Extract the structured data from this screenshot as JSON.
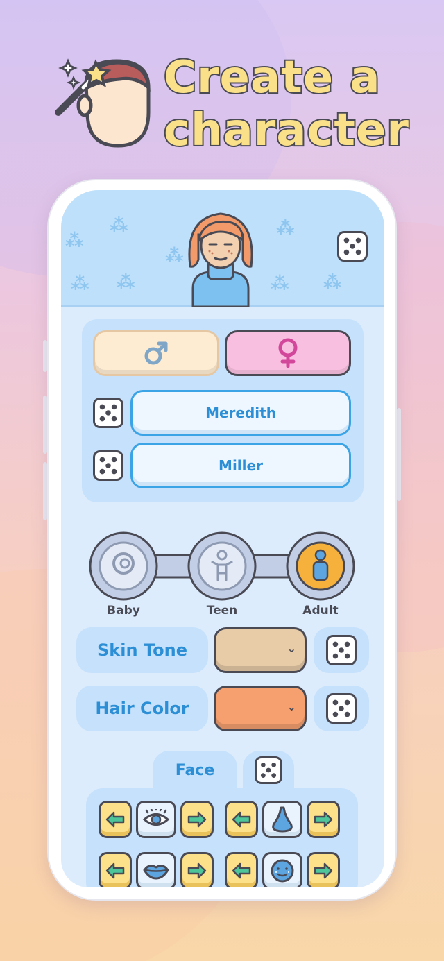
{
  "hero": {
    "title": "Create a character",
    "icon": "wand-character-icon"
  },
  "header": {
    "randomize_icon": "dice-icon"
  },
  "identity": {
    "gender_male_icon": "male-symbol-icon",
    "gender_female_icon": "female-symbol-icon",
    "selected_gender": "female",
    "first_name": "Meredith",
    "last_name": "Miller"
  },
  "age": {
    "options": [
      "Baby",
      "Teen",
      "Adult"
    ],
    "selected": "Adult"
  },
  "appearance": {
    "skin_label": "Skin Tone",
    "skin_color": "#e8cba7",
    "hair_label": "Hair Color",
    "hair_color": "#f6a06f"
  },
  "features": {
    "tab_label": "Face",
    "rows": [
      [
        "eye-icon",
        "nose-icon"
      ],
      [
        "lips-icon",
        "freckle-face-icon"
      ]
    ]
  },
  "colors": {
    "accent": "#2c8fd6",
    "outline": "#4a4a55",
    "arrow_yellow": "#fde18a",
    "arrow_green": "#4dc59a",
    "selected_age": "#f5b13c"
  }
}
